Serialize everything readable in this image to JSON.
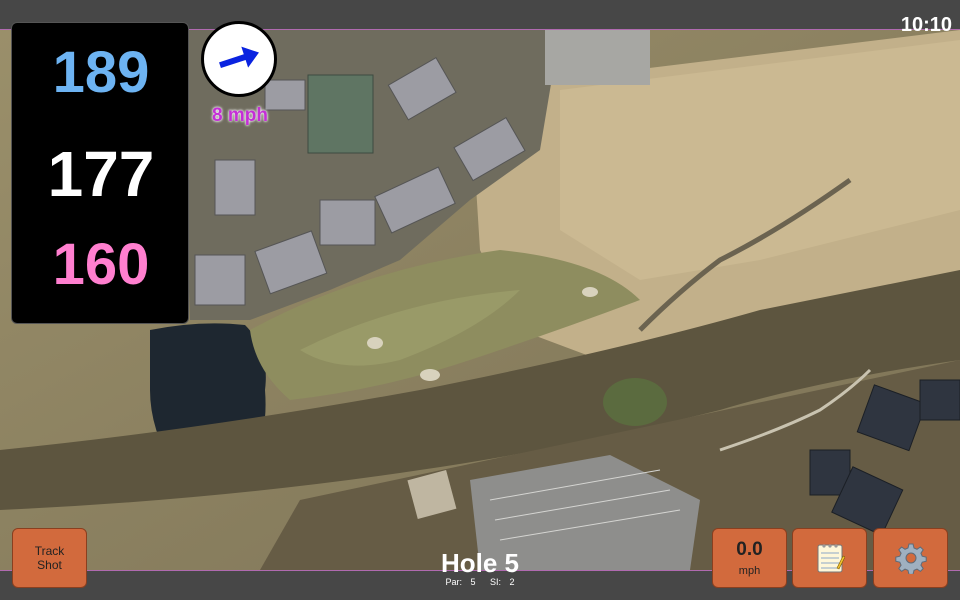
{
  "status": {
    "clock": "10:10"
  },
  "distances": {
    "back": "189",
    "middle": "177",
    "front": "160"
  },
  "wind": {
    "speed_label": "8 mph",
    "direction_icon": "wind-arrow-icon",
    "arrow_color": "#0a23e0"
  },
  "buttons": {
    "track_shot_label": "Track\nShot",
    "speed_value": "0.0",
    "speed_unit": "mph",
    "notes_icon": "notepad-icon",
    "settings_icon": "gear-icon"
  },
  "hole": {
    "title": "Hole 5",
    "par_label": "Par:",
    "par_value": "5",
    "si_label": "SI:",
    "si_value": "2"
  },
  "colors": {
    "back_distance": "#6db3f2",
    "middle_distance": "#ffffff",
    "front_distance": "#ff7fcf",
    "wind_text": "#c42fd6",
    "button": "#d26a3d",
    "bar": "#474747"
  }
}
